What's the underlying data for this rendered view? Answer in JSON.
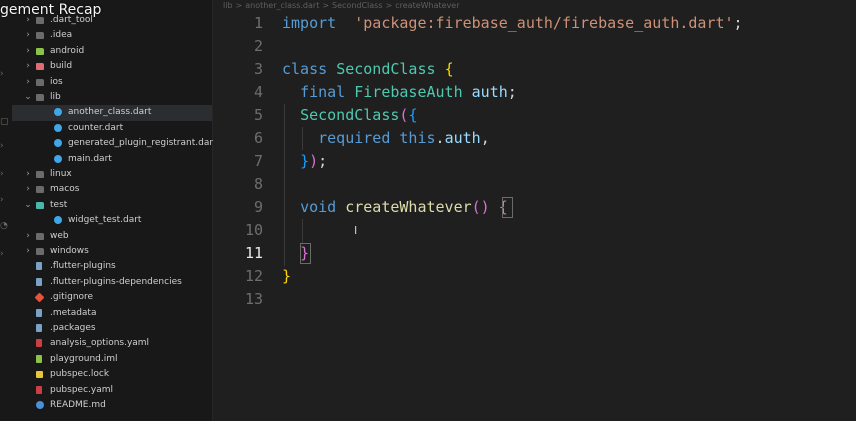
{
  "overlay_title": "gement Recap",
  "breadcrumb": [
    "lib",
    ">",
    "another_class.dart",
    ">",
    "SecondClass",
    ">",
    "createWhatever"
  ],
  "explorer": [
    {
      "label": ".dart_tool",
      "type": "folder",
      "expanded": false
    },
    {
      "label": ".idea",
      "type": "folder",
      "expanded": false
    },
    {
      "label": "android",
      "type": "folder-android",
      "expanded": false
    },
    {
      "label": "build",
      "type": "folder-build",
      "expanded": false
    },
    {
      "label": "ios",
      "type": "folder",
      "expanded": false
    },
    {
      "label": "lib",
      "type": "folder",
      "expanded": true
    },
    {
      "label": "another_class.dart",
      "type": "dart",
      "selected": true
    },
    {
      "label": "counter.dart",
      "type": "dart"
    },
    {
      "label": "generated_plugin_registrant.dart",
      "type": "dart"
    },
    {
      "label": "main.dart",
      "type": "dart"
    },
    {
      "label": "linux",
      "type": "folder",
      "expanded": false
    },
    {
      "label": "macos",
      "type": "folder",
      "expanded": false
    },
    {
      "label": "test",
      "type": "folder-test",
      "expanded": true
    },
    {
      "label": "widget_test.dart",
      "type": "dart"
    },
    {
      "label": "web",
      "type": "folder",
      "expanded": false
    },
    {
      "label": "windows",
      "type": "folder",
      "expanded": false
    },
    {
      "label": ".flutter-plugins",
      "type": "file"
    },
    {
      "label": ".flutter-plugins-dependencies",
      "type": "file"
    },
    {
      "label": ".gitignore",
      "type": "git"
    },
    {
      "label": ".metadata",
      "type": "file"
    },
    {
      "label": ".packages",
      "type": "file"
    },
    {
      "label": "analysis_options.yaml",
      "type": "yaml"
    },
    {
      "label": "playground.iml",
      "type": "iml"
    },
    {
      "label": "pubspec.lock",
      "type": "lock"
    },
    {
      "label": "pubspec.yaml",
      "type": "yaml"
    },
    {
      "label": "README.md",
      "type": "md"
    }
  ],
  "editor": {
    "active_line": 11,
    "lines": [
      {
        "n": "1",
        "tokens": [
          [
            "kw",
            "import"
          ],
          [
            "",
            "  "
          ],
          [
            "str",
            "'package:firebase_auth/firebase_auth.dart'"
          ],
          [
            "",
            ";"
          ]
        ]
      },
      {
        "n": "2",
        "tokens": []
      },
      {
        "n": "3",
        "tokens": [
          [
            "kw",
            "class"
          ],
          [
            "",
            " "
          ],
          [
            "cls",
            "SecondClass"
          ],
          [
            "",
            " "
          ],
          [
            "br1",
            "{"
          ]
        ]
      },
      {
        "n": "4",
        "tokens": [
          [
            "",
            "  "
          ],
          [
            "kw",
            "final"
          ],
          [
            "",
            " "
          ],
          [
            "cls",
            "FirebaseAuth"
          ],
          [
            "",
            " "
          ],
          [
            "ident",
            "auth"
          ],
          [
            "",
            ";"
          ]
        ]
      },
      {
        "n": "5",
        "tokens": [
          [
            "",
            "  "
          ],
          [
            "cls",
            "SecondClass"
          ],
          [
            "br2",
            "("
          ],
          [
            "br3",
            "{"
          ]
        ]
      },
      {
        "n": "6",
        "tokens": [
          [
            "",
            "    "
          ],
          [
            "kw",
            "required"
          ],
          [
            "",
            " "
          ],
          [
            "kw",
            "this"
          ],
          [
            "",
            "."
          ],
          [
            "ident",
            "auth"
          ],
          [
            "",
            ","
          ]
        ]
      },
      {
        "n": "7",
        "tokens": [
          [
            "",
            "  "
          ],
          [
            "br3",
            "}"
          ],
          [
            "br2",
            ")"
          ],
          [
            "",
            ";"
          ]
        ]
      },
      {
        "n": "8",
        "tokens": []
      },
      {
        "n": "9",
        "tokens": [
          [
            "",
            "  "
          ],
          [
            "kw",
            "void"
          ],
          [
            "",
            " "
          ],
          [
            "fn",
            "createWhatever"
          ],
          [
            "br2",
            "()"
          ],
          [
            "",
            " "
          ],
          [
            "br2",
            "{"
          ]
        ]
      },
      {
        "n": "10",
        "tokens": []
      },
      {
        "n": "11",
        "tokens": [
          [
            "",
            "  "
          ],
          [
            "br2",
            "}"
          ]
        ]
      },
      {
        "n": "12",
        "tokens": [
          [
            "br1",
            "}"
          ]
        ]
      },
      {
        "n": "13",
        "tokens": []
      }
    ]
  }
}
